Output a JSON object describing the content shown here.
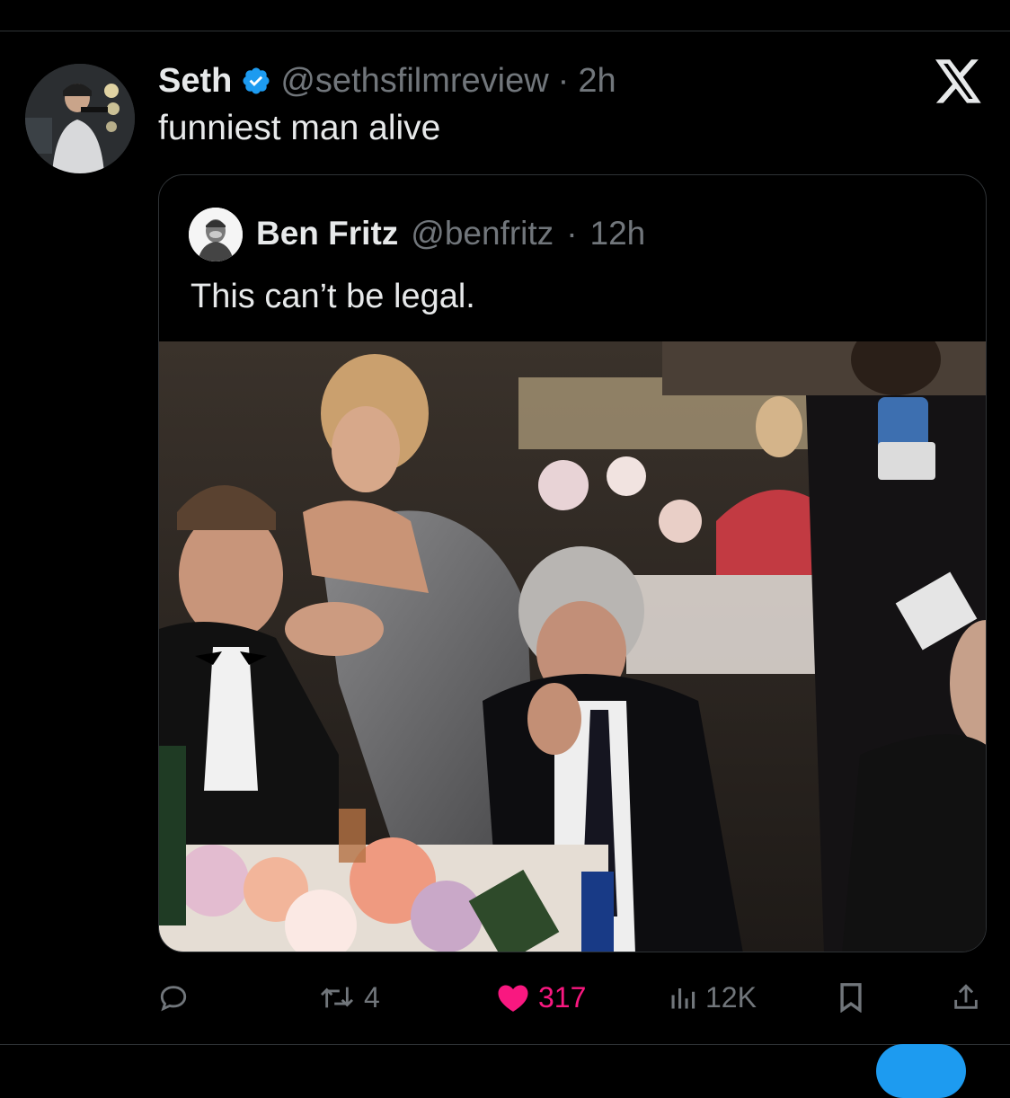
{
  "tweet": {
    "author_name": "Seth",
    "handle": "@sethsfilmreview",
    "separator": "·",
    "time": "2h",
    "text": "funniest man alive"
  },
  "quoted": {
    "author_name": "Ben Fritz",
    "handle": "@benfritz",
    "separator": "·",
    "time": "12h",
    "text": "This can’t be legal."
  },
  "actions": {
    "reply_count": "",
    "retweet_count": "4",
    "like_count": "317",
    "view_count": "12K"
  },
  "icons": {
    "brand": "x-logo-icon",
    "verified": "verified-badge-icon",
    "reply": "reply-icon",
    "retweet": "retweet-icon",
    "like": "heart-icon",
    "views": "views-icon",
    "bookmark": "bookmark-icon",
    "share": "share-icon"
  },
  "colors": {
    "background": "#000000",
    "text": "#e7e9ea",
    "muted": "#71767b",
    "verified": "#1d9bf0",
    "like": "#f91880"
  }
}
